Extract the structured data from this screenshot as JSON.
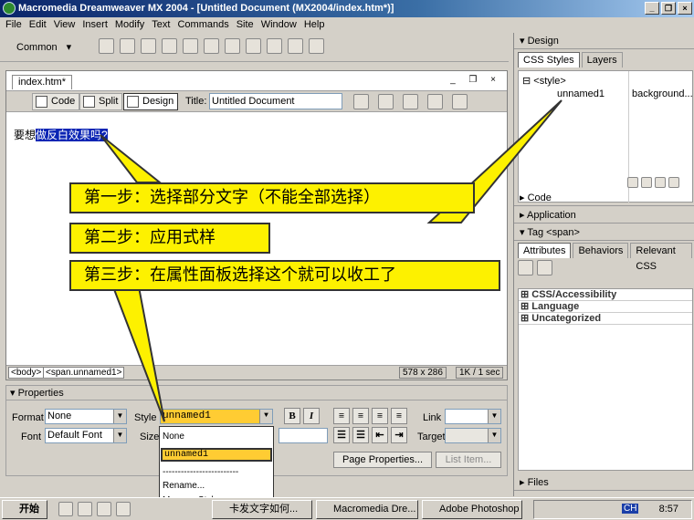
{
  "window": {
    "title": "Macromedia Dreamweaver MX 2004 - [Untitled Document (MX2004/index.htm*)]"
  },
  "menu": [
    "File",
    "Edit",
    "View",
    "Insert",
    "Modify",
    "Text",
    "Commands",
    "Site",
    "Window",
    "Help"
  ],
  "insert_bar": {
    "category": "Common"
  },
  "document": {
    "tab": "index.htm*",
    "views": {
      "code": "Code",
      "split": "Split",
      "design": "Design"
    },
    "title_label": "Title:",
    "title_value": "Untitled Document",
    "text_plain": "要想",
    "text_selected": "做反白效果吗?",
    "tag_body": "<body>",
    "tag_span": "<span.unnamed1>",
    "window_size": "578 x 286",
    "download": "1K / 1 sec"
  },
  "properties": {
    "header": "Properties",
    "format_label": "Format",
    "format_value": "None",
    "style_label": "Style",
    "style_value": "unnamed1",
    "font_label": "Font",
    "font_value": "Default Font",
    "size_label": "Size",
    "link_label": "Link",
    "target_label": "Target",
    "bold": "B",
    "italic": "I",
    "page_properties": "Page Properties...",
    "list_item": "List Item..."
  },
  "style_dropdown": {
    "items": [
      "None",
      "unnamed1",
      "-------------------------",
      "Rename...",
      "Manage Styles..."
    ],
    "selected_index": 1
  },
  "right_panel": {
    "design_header": "Design",
    "tabs": [
      "CSS Styles",
      "Layers"
    ],
    "css_tree": {
      "root": "<style>",
      "rule": "unnamed1",
      "rule_value": "background..."
    },
    "code_header": "Code",
    "application_header": "Application",
    "tag_header": "Tag <span>",
    "attr_tabs": [
      "Attributes",
      "Behaviors",
      "Relevant CSS"
    ],
    "categories": [
      "CSS/Accessibility",
      "Language",
      "Uncategorized"
    ],
    "files_header": "Files"
  },
  "callouts": [
    "第一步：选择部分文字（不能全部选择）",
    "第二步：应用式样",
    "第三步：在属性面板选择这个就可以收工了"
  ],
  "taskbar": {
    "start": "开始",
    "tasks": [
      "卡发文字如何...",
      "Macromedia Dre...",
      "Adobe Photoshop"
    ],
    "clock": "8:57",
    "ime": "CH"
  }
}
